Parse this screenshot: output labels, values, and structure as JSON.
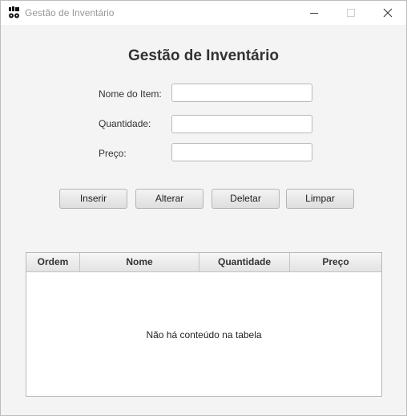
{
  "window": {
    "title": "Gestão de Inventário",
    "icons": {
      "app": "app-icon",
      "minimize": "minimize-icon",
      "maximize": "maximize-icon",
      "close": "close-icon"
    }
  },
  "form": {
    "heading": "Gestão de Inventário",
    "fields": [
      {
        "label": "Nome do Item:",
        "value": "",
        "placeholder": ""
      },
      {
        "label": "Quantidade:",
        "value": "",
        "placeholder": ""
      },
      {
        "label": "Preço:",
        "value": "",
        "placeholder": ""
      }
    ]
  },
  "buttons": {
    "insert": "Inserir",
    "update": "Alterar",
    "delete": "Deletar",
    "clear": "Limpar"
  },
  "table": {
    "columns": [
      "Ordem",
      "Nome",
      "Quantidade",
      "Preço"
    ],
    "rows": [],
    "empty_message": "Não há conteúdo na tabela"
  }
}
